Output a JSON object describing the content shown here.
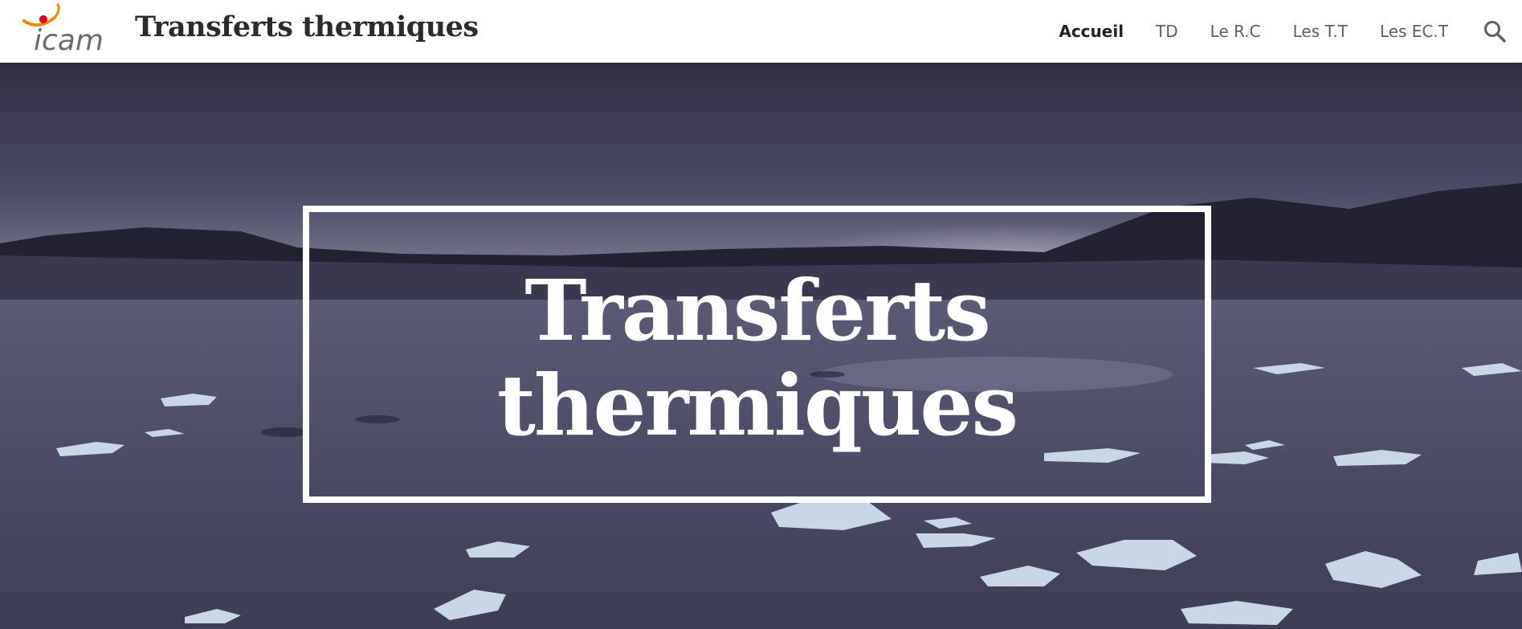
{
  "header": {
    "logo": {
      "text": "icam",
      "accent_color": "#f08a00",
      "dot_color": "#e2001a"
    },
    "site_title": "Transferts thermiques"
  },
  "nav": {
    "items": [
      {
        "label": "Accueil",
        "active": true
      },
      {
        "label": "TD",
        "active": false
      },
      {
        "label": "Le R.C",
        "active": false
      },
      {
        "label": "Les T.T",
        "active": false
      },
      {
        "label": "Les EC.T",
        "active": false
      }
    ],
    "search_icon": "search-icon"
  },
  "hero": {
    "title": "Transferts thermiques",
    "background": "ice-lagoon-landscape"
  }
}
